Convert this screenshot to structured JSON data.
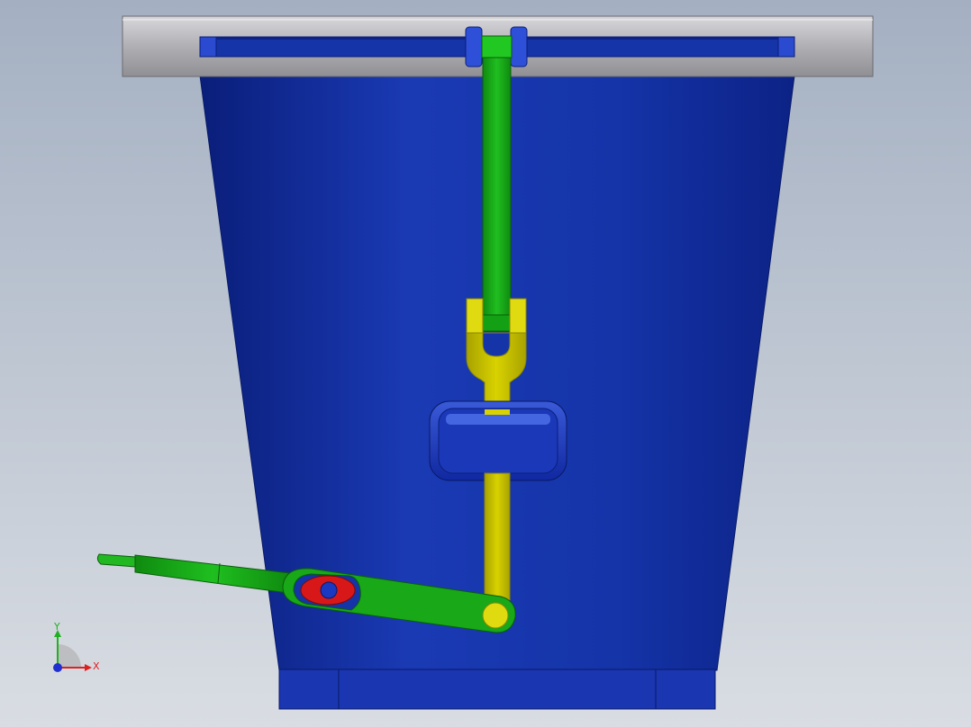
{
  "viewport": {
    "background_top": "#a4b0c2",
    "background_bottom": "#d9dde3"
  },
  "colors": {
    "hopper_blue": "#1534a8",
    "hopper_dark": "#0b1f78",
    "flange_gray": "#b8b8bc",
    "link_green": "#17a517",
    "link_dark": "#0b6e0b",
    "clevis_yellow": "#c8c200",
    "pin_red": "#d81818",
    "axis_x": "#e02020",
    "axis_y": "#20b020",
    "axis_z": "#2030d0"
  },
  "triad": {
    "x_label": "X",
    "y_label": "Y"
  }
}
